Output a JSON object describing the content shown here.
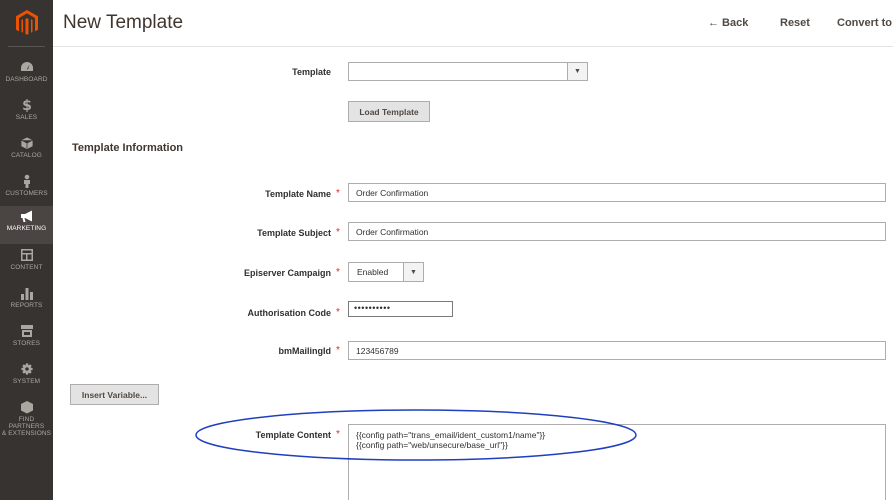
{
  "sidebar": {
    "logo": "magento-logo-icon",
    "items": [
      {
        "label": "DASHBOARD",
        "icon": "speedometer-icon"
      },
      {
        "label": "SALES",
        "icon": "dollar-icon"
      },
      {
        "label": "CATALOG",
        "icon": "cube-icon"
      },
      {
        "label": "CUSTOMERS",
        "icon": "person-icon"
      },
      {
        "label": "MARKETING",
        "icon": "megaphone-icon"
      },
      {
        "label": "CONTENT",
        "icon": "layout-icon"
      },
      {
        "label": "REPORTS",
        "icon": "bar-chart-icon"
      },
      {
        "label": "STORES",
        "icon": "storefront-icon"
      },
      {
        "label": "SYSTEM",
        "icon": "gear-icon"
      },
      {
        "label_line1": "FIND PARTNERS",
        "label_line2": "& EXTENSIONS",
        "icon": "partners-cube-icon"
      }
    ]
  },
  "header": {
    "title": "New Template",
    "back_label": "← Back",
    "reset_label": "Reset",
    "convert_label": "Convert to"
  },
  "load": {
    "template_label": "Template",
    "template_value": "",
    "load_button": "Load Template"
  },
  "info": {
    "section_title": "Template Information",
    "name_label": "Template Name",
    "name_value": "Order Confirmation",
    "subject_label": "Template Subject",
    "subject_value": "Order Confirmation",
    "campaign_label": "Episerver Campaign",
    "campaign_value": "Enabled",
    "auth_label": "Authorisation Code",
    "auth_value": "••••••••••",
    "mailing_label": "bmMailingId",
    "mailing_value": "123456789",
    "insert_variable": "Insert Variable...",
    "content_label": "Template Content",
    "content_line1": "{{config path=\"trans_email/ident_custom1/name\"}}",
    "content_line2": "{{config path=\"web/unsecure/base_url\"}}",
    "required_mark": "*"
  },
  "colors": {
    "sidebar_bg": "#373330",
    "logo_orange": "#eb5202",
    "required": "#e22626",
    "annotation": "#1f3fbf"
  }
}
